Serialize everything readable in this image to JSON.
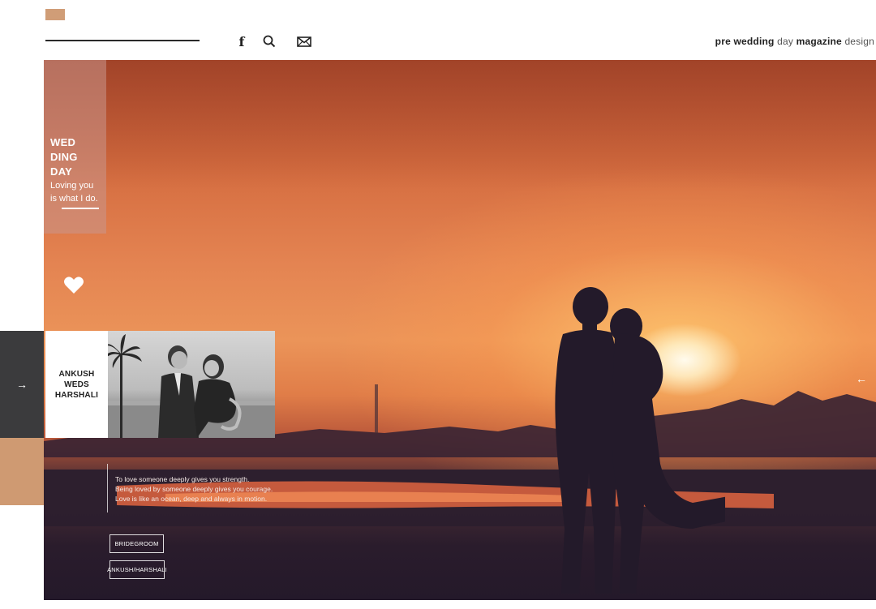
{
  "header": {
    "tagline": {
      "w1": "pre wedding",
      "w2": "day",
      "w3": "magazine",
      "w4": "design"
    },
    "icons": [
      "facebook-icon",
      "search-icon",
      "mail-icon"
    ]
  },
  "side_panel": {
    "title_lines": [
      "WED",
      "DING",
      "DAY"
    ],
    "subtitle_lines": [
      "Loving you",
      "is what I do."
    ]
  },
  "names_card": {
    "lines": [
      "ANKUSH",
      "WEDS",
      "HARSHALI"
    ]
  },
  "quote": {
    "lines": [
      "To love someone deeply gives you strength.",
      "Being loved by someone deeply gives you courage.",
      "Love is like an ocean, deep and always in motion."
    ]
  },
  "buttons": {
    "bridegroom": "BRIDEGROOM",
    "couple": "ANKUSH/HARSHALI"
  },
  "nav": {
    "left_arrow": "→",
    "right_arrow": "←"
  },
  "colors": {
    "accent": "#d09d77",
    "dark_panel": "#3b3b3d",
    "sunset_orange": "#e48452"
  }
}
